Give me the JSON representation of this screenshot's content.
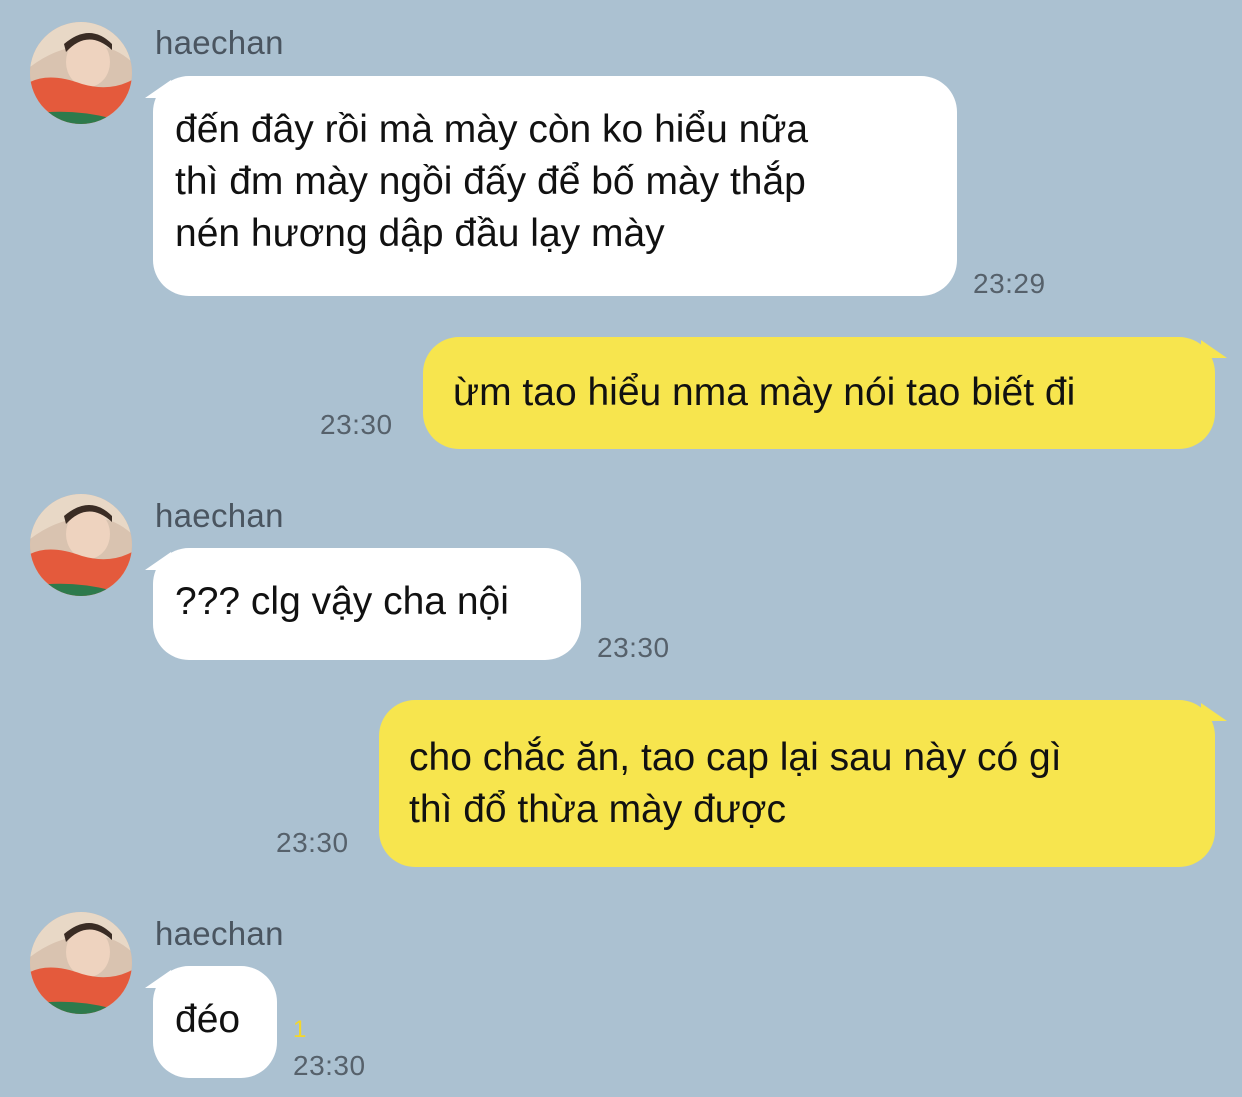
{
  "colors": {
    "background": "#abc1d1",
    "incoming_bubble": "#ffffff",
    "outgoing_bubble": "#f7e54e",
    "unread_badge": "#f4d72a"
  },
  "messages": [
    {
      "direction": "incoming",
      "sender": "haechan",
      "lines": [
        "đến đây rồi mà mày còn ko hiểu nữa",
        "thì đm mày ngồi đấy để bố mày thắp",
        "nén hương dập đầu lạy mày"
      ],
      "time": "23:29"
    },
    {
      "direction": "outgoing",
      "lines": [
        "ừm tao hiểu nma mày nói tao biết đi"
      ],
      "time": "23:30"
    },
    {
      "direction": "incoming",
      "sender": "haechan",
      "lines": [
        "??? clg vậy cha nội"
      ],
      "time": "23:30"
    },
    {
      "direction": "outgoing",
      "lines": [
        "cho chắc ăn, tao cap lại sau này có gì",
        "thì đổ thừa mày được"
      ],
      "time": "23:30"
    },
    {
      "direction": "incoming",
      "sender": "haechan",
      "lines": [
        "đéo"
      ],
      "unread_count": "1",
      "time": "23:30"
    }
  ]
}
